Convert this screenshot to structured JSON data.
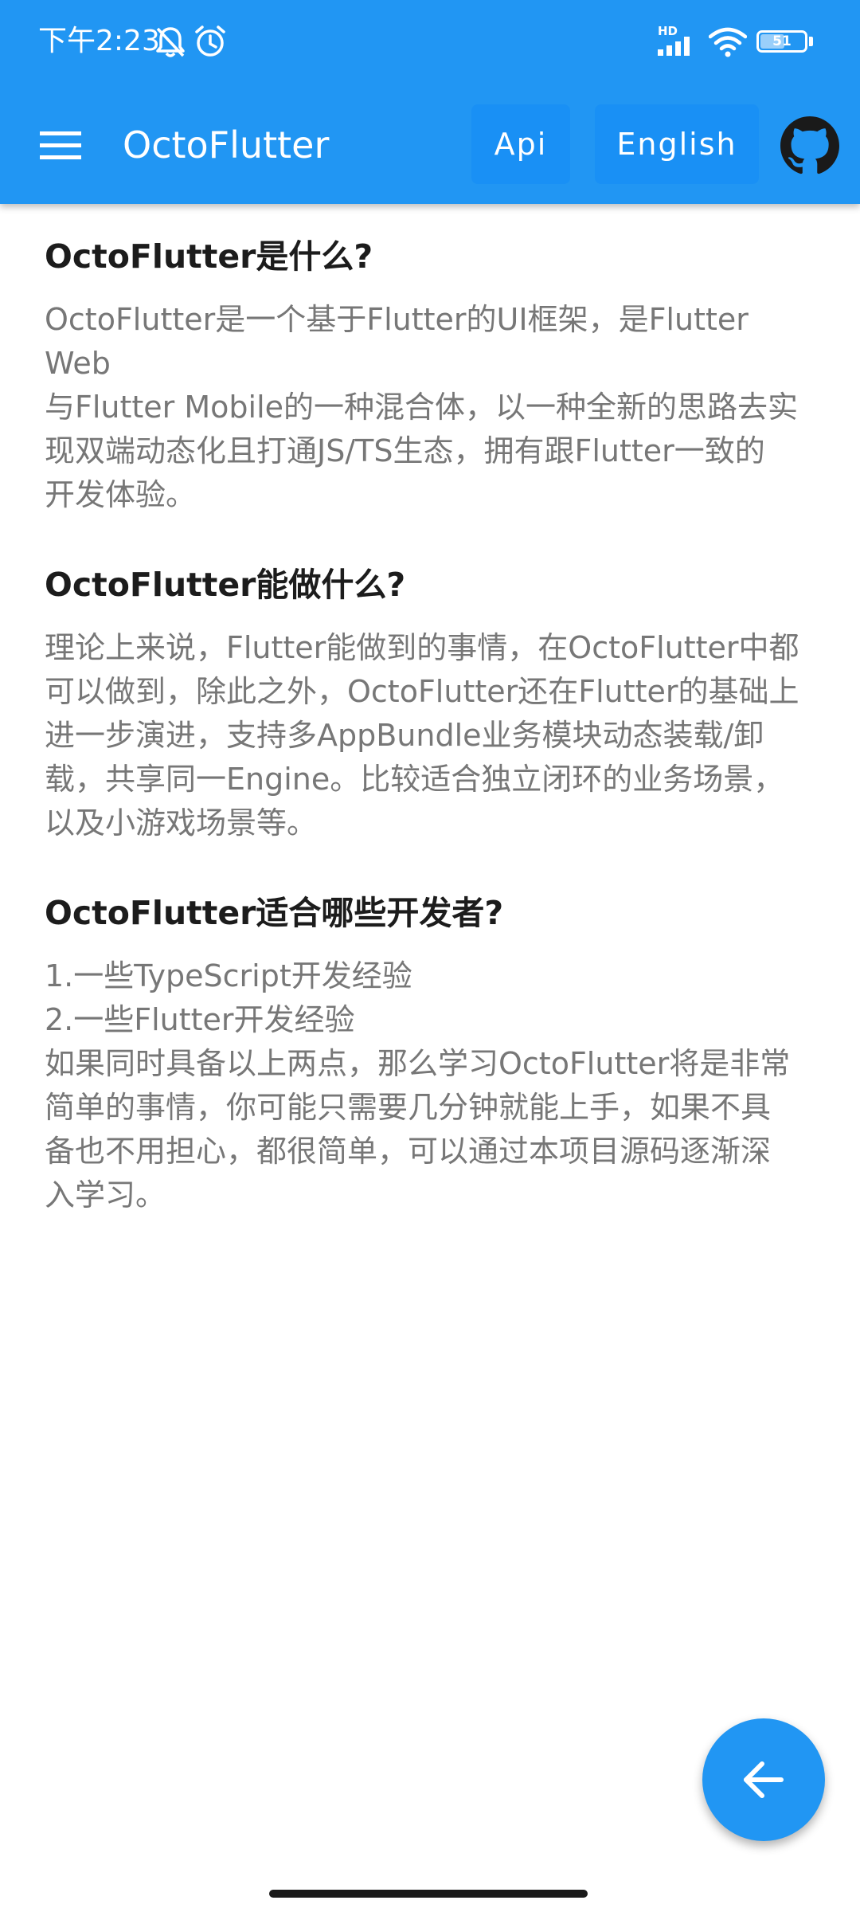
{
  "status_bar": {
    "time": "下午2:23",
    "network": "HD",
    "battery": "51",
    "icons": [
      "bell-off-icon",
      "alarm-icon",
      "signal-icon",
      "wifi-icon",
      "battery-icon"
    ]
  },
  "app_bar": {
    "title": "OctoFlutter",
    "buttons": {
      "api": "Api",
      "language": "English"
    },
    "icons": [
      "menu-icon",
      "github-icon"
    ],
    "color": "#2196f3"
  },
  "sections": [
    {
      "heading": "OctoFlutter是什么?",
      "lines": [
        "OctoFlutter是一个基于Flutter的UI框架，是Flutter Web",
        "与Flutter Mobile的一种混合体，以一种全新的思路去实",
        "现双端动态化且打通JS/TS生态，拥有跟Flutter一致的",
        "开发体验。"
      ]
    },
    {
      "heading": "OctoFlutter能做什么?",
      "lines": [
        "理论上来说，Flutter能做到的事情，在OctoFlutter中都",
        "可以做到，除此之外，OctoFlutter还在Flutter的基础上",
        "进一步演进，支持多AppBundle业务模块动态装载/卸",
        "载，共享同一Engine。比较适合独立闭环的业务场景，",
        "以及小游戏场景等。"
      ]
    },
    {
      "heading": "OctoFlutter适合哪些开发者?",
      "lines": [
        "1.一些TypeScript开发经验",
        "2.一些Flutter开发经验",
        "如果同时具备以上两点，那么学习OctoFlutter将是非常",
        "简单的事情，你可能只需要几分钟就能上手，如果不具",
        "备也不用担心，都很简单，可以通过本项目源码逐渐深",
        "入学习。"
      ]
    }
  ],
  "fab": {
    "icon": "arrow-left-icon"
  }
}
